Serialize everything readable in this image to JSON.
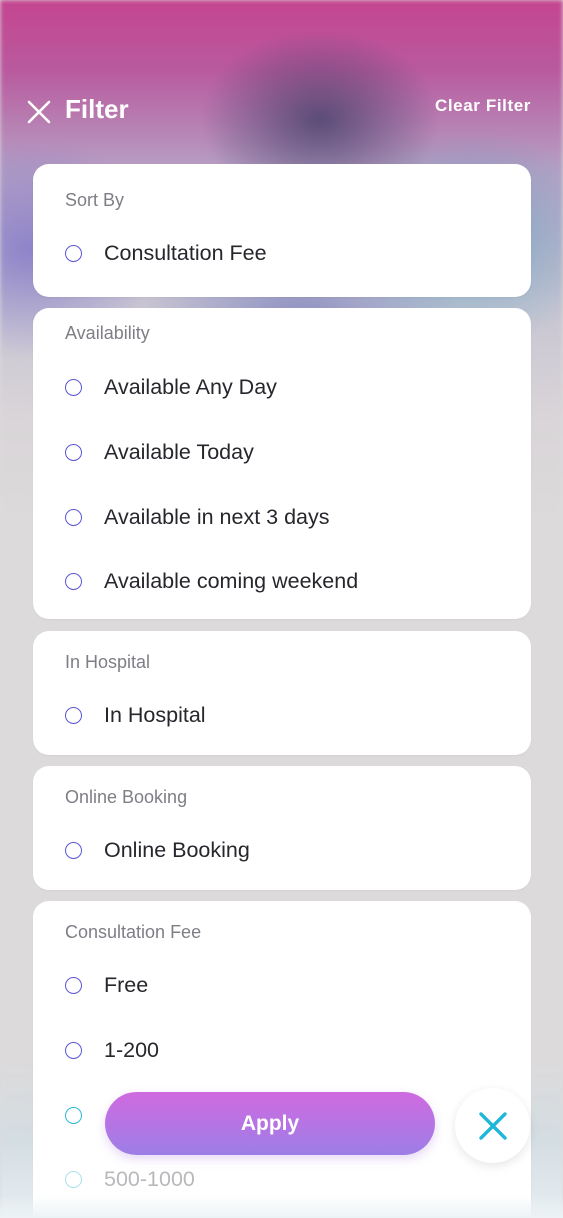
{
  "header": {
    "title": "Filter",
    "clear_label": "Clear Filter",
    "close_icon": "close-icon"
  },
  "sections": {
    "sort_by": {
      "title": "Sort By",
      "options": [
        "Consultation Fee"
      ]
    },
    "availability": {
      "title": "Availability",
      "options": [
        "Available Any Day",
        "Available Today",
        "Available in next 3 days",
        "Available coming weekend"
      ]
    },
    "in_hospital": {
      "title": "In Hospital",
      "options": [
        "In Hospital"
      ]
    },
    "online_booking": {
      "title": "Online Booking",
      "options": [
        "Online Booking"
      ]
    },
    "consultation_fee": {
      "title": "Consultation Fee",
      "options": [
        "Free",
        "1-200",
        "500-1000"
      ]
    }
  },
  "footer": {
    "apply_label": "Apply",
    "dismiss_icon": "close-icon"
  },
  "colors": {
    "radio_border": "#5b56d6",
    "accent_teal": "#2bb8d6",
    "apply_gradient_top": "#d06ae0",
    "apply_gradient_bottom": "#9d7ee6"
  }
}
